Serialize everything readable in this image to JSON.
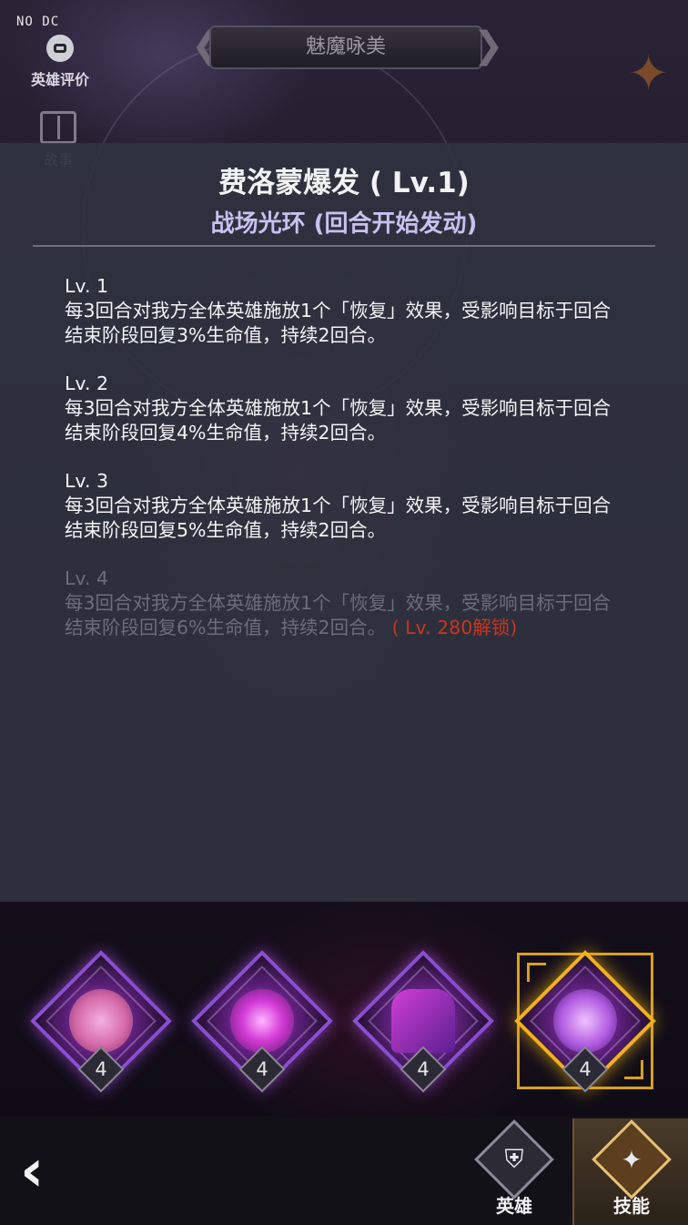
{
  "top": {
    "debug_label": "NO DC",
    "evaluate_label": "英雄评价",
    "hero_title": "魅魔咏美",
    "story_label": "故事"
  },
  "skill": {
    "name": "费洛蒙爆发 ( Lv.1)",
    "type": "战场光环 (回合开始发动)",
    "levels": [
      {
        "title": "Lv. 1",
        "desc": "每3回合对我方全体英雄施放1个「恢复」效果，受影响目标于回合结束阶段回复3%生命值，持续2回合。",
        "unlock": ""
      },
      {
        "title": "Lv. 2",
        "desc": "每3回合对我方全体英雄施放1个「恢复」效果，受影响目标于回合结束阶段回复4%生命值，持续2回合。",
        "unlock": ""
      },
      {
        "title": "Lv. 3",
        "desc": "每3回合对我方全体英雄施放1个「恢复」效果，受影响目标于回合结束阶段回复5%生命值，持续2回合。",
        "unlock": ""
      },
      {
        "title": "Lv. 4",
        "desc": "每3回合对我方全体英雄施放1个「恢复」效果，受影响目标于回合结束阶段回复6%生命值，持续2回合。",
        "unlock": " ( Lv. 280解锁)"
      }
    ]
  },
  "skill_icons": [
    {
      "icon": "pocket-watch-icon",
      "level": "4"
    },
    {
      "icon": "pink-orb-icon",
      "level": "4"
    },
    {
      "icon": "silhouettes-icon",
      "level": "4"
    },
    {
      "icon": "succubus-icon",
      "level": "4",
      "selected": true
    }
  ],
  "nav": {
    "hero_label": "英雄",
    "skill_label": "技能"
  },
  "colors": {
    "accent_purple": "#c8c0ee",
    "locked_text": "#6b6d78",
    "unlock_red": "#c9351f",
    "selected_gold": "#f0b21c"
  }
}
